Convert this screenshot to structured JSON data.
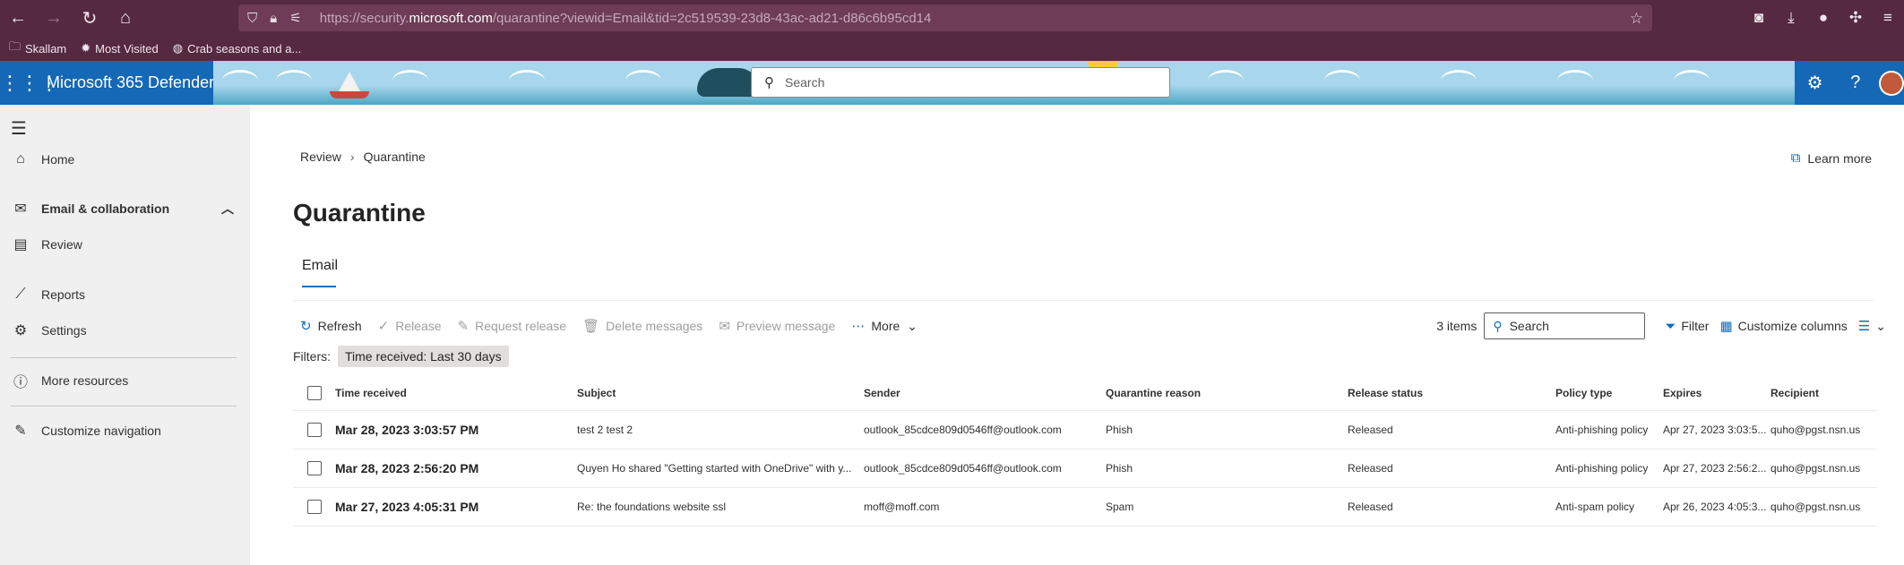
{
  "browser": {
    "url_prefix": "https://security.",
    "url_domain": "microsoft.com",
    "url_path": "/quarantine?viewid=Email&tid=2c519539-23d8-43ac-ad21-d86c6b95cd14",
    "bookmarks": [
      {
        "icon": "folder-icon",
        "label": "Skallam"
      },
      {
        "icon": "gear-icon",
        "label": "Most Visited"
      },
      {
        "icon": "globe-icon",
        "label": "Crab seasons and a..."
      }
    ]
  },
  "app": {
    "name": "Microsoft 365 Defender",
    "search_placeholder": "Search"
  },
  "sidebar": {
    "items": [
      {
        "label": "Home",
        "icon": "home-icon"
      },
      {
        "label": "Email & collaboration",
        "icon": "mail-icon"
      },
      {
        "label": "Review",
        "icon": "document-icon"
      },
      {
        "label": "Reports",
        "icon": "chart-icon"
      },
      {
        "label": "Settings",
        "icon": "gear-icon"
      },
      {
        "label": "More resources",
        "icon": "info-icon"
      },
      {
        "label": "Customize navigation",
        "icon": "pencil-icon"
      }
    ]
  },
  "page": {
    "breadcrumb": [
      "Review",
      "Quarantine"
    ],
    "learn_more": "Learn more",
    "title": "Quarantine",
    "tab": "Email"
  },
  "toolbar": {
    "refresh": "Refresh",
    "release": "Release",
    "request_release": "Request release",
    "delete_messages": "Delete messages",
    "preview_message": "Preview message",
    "more": "More",
    "items_count": "3 items",
    "search_placeholder": "Search",
    "filter": "Filter",
    "customize_columns": "Customize columns"
  },
  "filters": {
    "label": "Filters:",
    "pill": "Time received: Last 30 days"
  },
  "table": {
    "columns": [
      "Time received",
      "Subject",
      "Sender",
      "Quarantine reason",
      "Release status",
      "Policy type",
      "Expires",
      "Recipient"
    ],
    "rows": [
      [
        "Mar 28, 2023 3:03:57 PM",
        "test 2 test 2",
        "outlook_85cdce809d0546ff@outlook.com",
        "Phish",
        "Released",
        "Anti-phishing policy",
        "Apr 27, 2023 3:03:5...",
        "quho@pgst.nsn.us"
      ],
      [
        "Mar 28, 2023 2:56:20 PM",
        "Quyen Ho shared \"Getting started with OneDrive\" with y...",
        "outlook_85cdce809d0546ff@outlook.com",
        "Phish",
        "Released",
        "Anti-phishing policy",
        "Apr 27, 2023 2:56:2...",
        "quho@pgst.nsn.us"
      ],
      [
        "Mar 27, 2023 4:05:31 PM",
        "Re: the foundations website ssl",
        "moff@moff.com",
        "Spam",
        "Released",
        "Anti-spam policy",
        "Apr 26, 2023 4:05:3...",
        "quho@pgst.nsn.us"
      ]
    ]
  }
}
